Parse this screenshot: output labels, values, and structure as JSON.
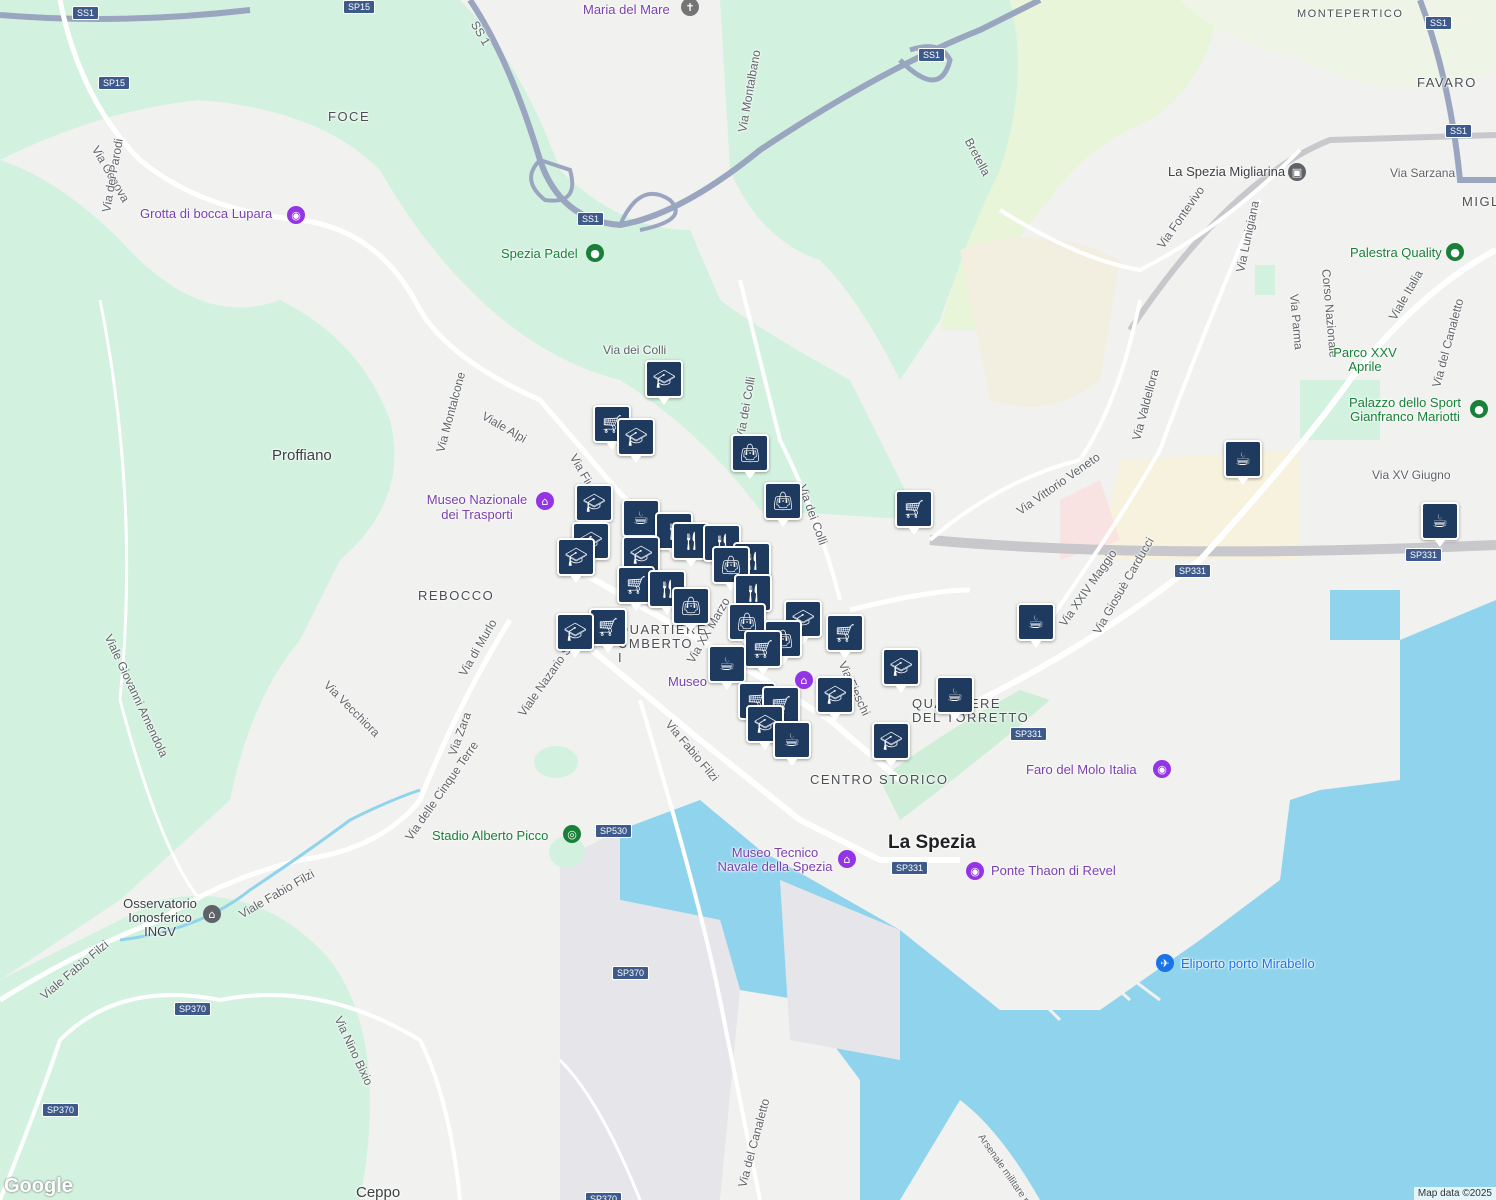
{
  "map": {
    "districts": [
      "FOCE",
      "REBOCCO",
      "MONTEPERTICO",
      "FAVARO",
      "MIGL",
      "QUARTIERE UMBERTO I",
      "CENTRO STORICO",
      "QUARTIERE DEL TORRETTO"
    ],
    "towns": [
      "Proffiano",
      "Ceppo"
    ],
    "city": "La Spezia",
    "roads": [
      "Via Genova",
      "Via dei Parodi",
      "Via Montalcone",
      "Viale Alpi",
      "Via Fiume",
      "Via dei Colli",
      "Via Montalbano",
      "Bretella",
      "Via Fontevivo",
      "Via Sarzana",
      "Via Lunigiana",
      "Corso Nazionale",
      "Via Parma",
      "Viale Italia",
      "Via del Canaletto",
      "Via del Cappelletto",
      "Via Valdellora",
      "Via Vittorio Veneto",
      "Via XXIV Maggio",
      "Via Giosuè Carducci",
      "Via XV Giugno",
      "Viale Nazario Sauro",
      "Via Zara",
      "Via di Murlo",
      "Via Vecchiora",
      "Viale Giovanni Amendola",
      "Via Fabio Filzi",
      "Viale Fabio Filzi",
      "Via delle Cinque Terre",
      "Via Nino Bixio",
      "Via XX Marzo",
      "Via Fieschi",
      "Via del Canaletto",
      "Var A",
      "SS 1"
    ],
    "shields": [
      "SS1",
      "SP15",
      "SS1",
      "SS1",
      "SS1",
      "SS1",
      "SP331",
      "SP331",
      "SP331",
      "SP331",
      "SP530",
      "SP370",
      "SP370",
      "SP370",
      "SP370"
    ],
    "pois": [
      {
        "name": "Maria del Mare",
        "kind": "worship"
      },
      {
        "name": "Grotta di bocca Lupara",
        "kind": "attraction"
      },
      {
        "name": "Spezia Padel",
        "kind": "sport"
      },
      {
        "name": "Museo Nazionale dei Trasporti",
        "kind": "attraction"
      },
      {
        "name": "La Spezia Migliarina",
        "kind": "transit"
      },
      {
        "name": "Palestra Quality",
        "kind": "sport"
      },
      {
        "name": "Parco XXV Aprile",
        "kind": "park"
      },
      {
        "name": "Palazzo dello Sport Gianfranco Mariotti",
        "kind": "sport"
      },
      {
        "name": "Faro del Molo Italia",
        "kind": "attraction"
      },
      {
        "name": "Stadio Alberto Picco",
        "kind": "stadium"
      },
      {
        "name": "Museo Tecnico Navale della Spezia",
        "kind": "attraction"
      },
      {
        "name": "Ponte Thaon di Revel",
        "kind": "attraction"
      },
      {
        "name": "Eliporto porto Mirabello",
        "kind": "airport"
      },
      {
        "name": "Osservatorio Ionosferico INGV",
        "kind": "institution"
      },
      {
        "name": "Museo",
        "kind": "attraction"
      },
      {
        "name": "Arsenale militare m",
        "kind": "area"
      }
    ],
    "markers": {
      "school": "school-icon",
      "grocery": "cart-icon",
      "restaurant": "fork-knife-icon",
      "shopping": "bag-icon",
      "cafe": "coffee-icon"
    },
    "colors": {
      "water": "#8fd4ec",
      "park": "#d2f2df",
      "road": "#ffffff",
      "highway": "#9aa6c0",
      "pin": "#1f3a5f"
    }
  },
  "footer": {
    "logo": "Google",
    "attribution": "Map data ©2025"
  }
}
